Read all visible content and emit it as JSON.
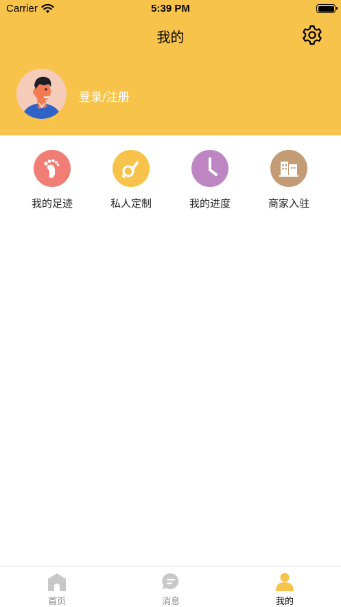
{
  "status_bar": {
    "carrier": "Carrier",
    "time": "5:39 PM"
  },
  "nav": {
    "title": "我的",
    "settings_icon": "gear-icon"
  },
  "profile": {
    "login_text": "登录/注册",
    "avatar_icon": "user-avatar"
  },
  "menu": {
    "items": [
      {
        "label": "我的足迹",
        "icon": "footprint-icon",
        "color": "#F07E74"
      },
      {
        "label": "私人定制",
        "icon": "custom-icon",
        "color": "#F8C34A"
      },
      {
        "label": "我的进度",
        "icon": "clock-icon",
        "color": "#BD86C3"
      },
      {
        "label": "商家入驻",
        "icon": "building-icon",
        "color": "#C39B74"
      }
    ]
  },
  "tabbar": {
    "tabs": [
      {
        "label": "首页",
        "icon": "home-icon",
        "active": false
      },
      {
        "label": "消息",
        "icon": "message-icon",
        "active": false
      },
      {
        "label": "我的",
        "icon": "person-icon",
        "active": true
      }
    ]
  },
  "colors": {
    "header_bg": "#F8C34A",
    "tab_inactive": "#C8C8C8",
    "tab_active": "#F8C34A"
  }
}
